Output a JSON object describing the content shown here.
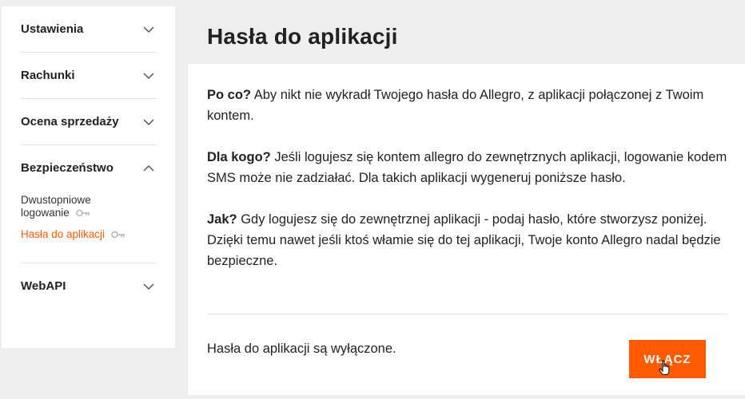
{
  "page": {
    "title": "Hasła do aplikacji"
  },
  "sidebar": {
    "sections": [
      {
        "label": "Ustawienia",
        "expanded": false,
        "icon": "chevron-down-icon"
      },
      {
        "label": "Rachunki",
        "expanded": false,
        "icon": "chevron-down-icon"
      },
      {
        "label": "Ocena sprzedaży",
        "expanded": false,
        "icon": "chevron-down-icon"
      },
      {
        "label": "Bezpieczeństwo",
        "expanded": true,
        "icon": "chevron-up-icon",
        "items": [
          {
            "label": "Dwustopniowe logowanie",
            "icon": "key-icon",
            "active": false
          },
          {
            "label": "Hasła do aplikacji",
            "icon": "key-icon",
            "active": true
          }
        ]
      },
      {
        "label": "WebAPI",
        "expanded": false,
        "icon": "chevron-down-icon"
      }
    ]
  },
  "content": {
    "paragraphs": [
      {
        "lead": "Po co?",
        "text": " Aby nikt nie wykradł Twojego hasła do Allegro, z aplikacji połączonej z Twoim kontem."
      },
      {
        "lead": "Dla kogo?",
        "text": " Jeśli logujesz się kontem allegro do zewnętrznych aplikacji, logowanie kodem SMS może nie zadziałać. Dla takich aplikacji wygeneruj poniższe hasło."
      },
      {
        "lead": "Jak?",
        "text": " Gdy logujesz się do zewnętrznej aplikacji - podaj hasło, które stworzysz poniżej. Dzięki temu nawet jeśli ktoś włamie się do tej aplikacji, Twoje konto Allegro nadal będzie bezpieczne."
      }
    ],
    "status": "Hasła do aplikacji są wyłączone.",
    "enable_button": "WŁĄCZ"
  },
  "colors": {
    "accent": "#ff5a00",
    "background": "#eeeeee",
    "panel": "#ffffff"
  }
}
